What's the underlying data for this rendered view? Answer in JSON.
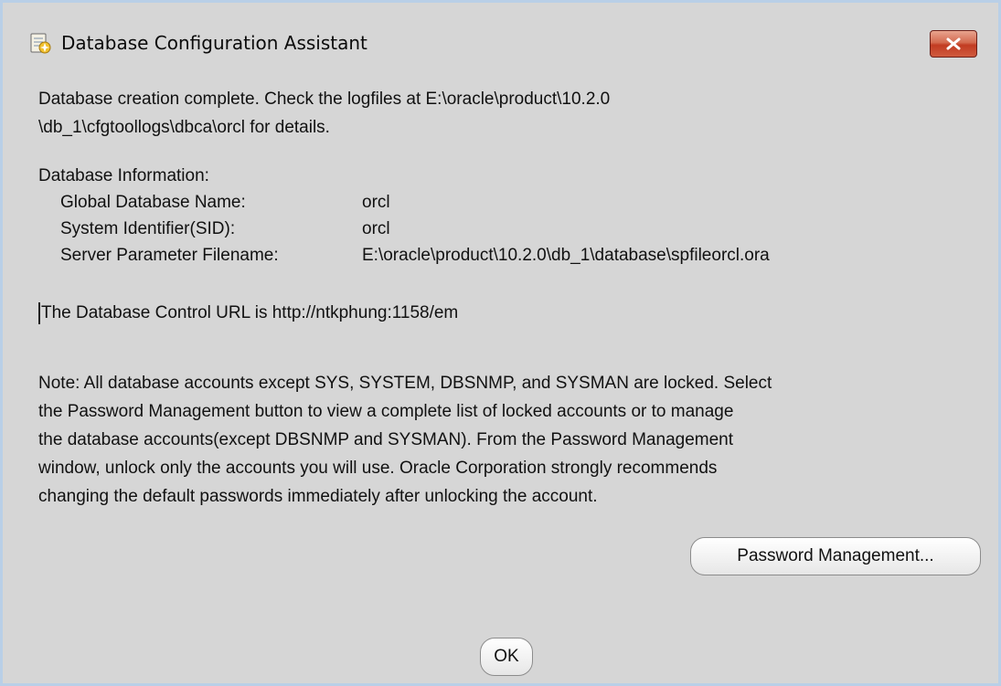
{
  "window": {
    "title": "Database Configuration Assistant",
    "icon": "database-assistant-icon",
    "close_icon": "close-icon",
    "close_color": "#c9452b"
  },
  "message": {
    "line1": "Database creation complete. Check the logfiles at E:\\oracle\\product\\10.2.0",
    "line2": "\\db_1\\cfgtoollogs\\dbca\\orcl for details."
  },
  "info": {
    "heading": "Database Information:",
    "rows": [
      {
        "label": "Global Database Name:",
        "value": "orcl"
      },
      {
        "label": "System Identifier(SID):",
        "value": "orcl"
      },
      {
        "label": "Server Parameter Filename:",
        "value": "E:\\oracle\\product\\10.2.0\\db_1\\database\\spfileorcl.ora"
      }
    ]
  },
  "control_url": "The Database Control URL is http://ntkphung:1158/em",
  "note": {
    "lines": [
      "Note: All database accounts except SYS, SYSTEM, DBSNMP, and SYSMAN are locked. Select",
      "the Password Management button to view a complete list of locked accounts or to manage",
      "the database accounts(except DBSNMP and SYSMAN). From the Password Management",
      "window, unlock only the accounts you will use. Oracle Corporation strongly recommends",
      "changing the default passwords immediately after unlocking the account."
    ]
  },
  "buttons": {
    "password_management": "Password Management...",
    "ok": "OK"
  }
}
